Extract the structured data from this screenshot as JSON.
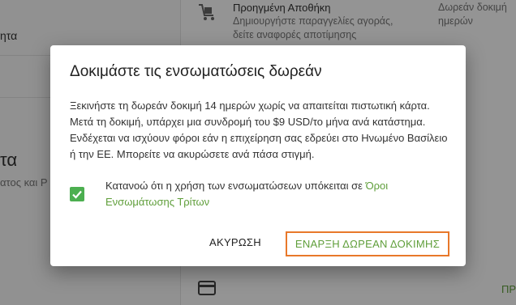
{
  "background": {
    "left_rows": [
      "ητα"
    ],
    "left_heading": "τα",
    "left_subtext": "ατος και Ρ",
    "item": {
      "title": "Προηγμένη Αποθήκη",
      "description": [
        "Δημιουργήστε παραγγελίες αγοράς,",
        "δείτε αναφορές αποτίμησης"
      ],
      "price": [
        "Δωρεάν δοκιμή",
        "ημερών"
      ]
    },
    "right_link": "ΠΡ"
  },
  "dialog": {
    "title": "Δοκιμάστε τις ενσωματώσεις δωρεάν",
    "body": "Ξεκινήστε τη δωρεάν δοκιμή 14 ημερών χωρίς να απαιτείται πιστωτική κάρτα. Μετά τη δοκιμή, υπάρχει μια συνδρομή του $9 USD/το μήνα ανά κατάστημα. Ενδέχεται να ισχύουν φόροι εάν η επιχείρηση σας εδρεύει στο Ηνωμένο Βασίλειο ή την ΕΕ. Μπορείτε να ακυρώσετε ανά πάσα στιγμή.",
    "terms_checked": true,
    "terms_text": "Κατανοώ ότι η χρήση των ενσωματώσεων υπόκειται σε ",
    "terms_link": "Όροι Ενσωμάτωσης Τρίτων",
    "cancel_label": "ΑΚΥΡΩΣΗ",
    "start_label": "ΕΝΑΡΞΗ ΔΩΡΕΑΝ ΔΟΚΙΜΗΣ"
  },
  "colors": {
    "accent_green": "#5f9e3a",
    "checkbox_green": "#4caf50",
    "highlight_orange": "#e8782a"
  },
  "icons": [
    "warehouse-cart-icon",
    "credit-card-icon",
    "checkmark-icon"
  ]
}
